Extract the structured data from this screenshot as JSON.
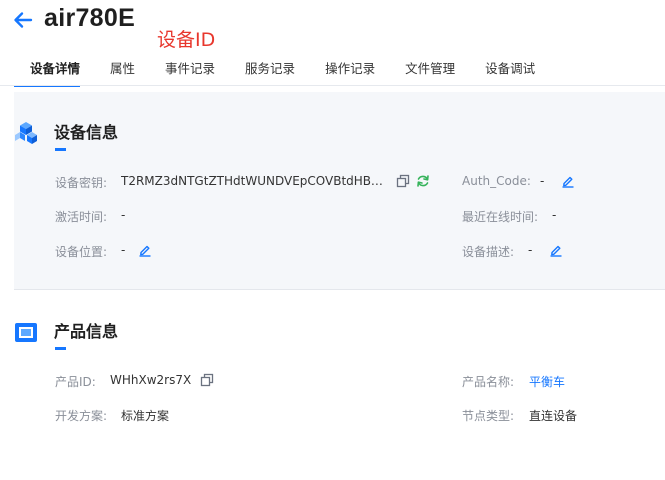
{
  "header": {
    "device_name": "air780E",
    "annotation": "设备ID"
  },
  "tabs": [
    {
      "label": "设备详情",
      "active": true
    },
    {
      "label": "属性",
      "active": false
    },
    {
      "label": "事件记录",
      "active": false
    },
    {
      "label": "服务记录",
      "active": false
    },
    {
      "label": "操作记录",
      "active": false
    },
    {
      "label": "文件管理",
      "active": false
    },
    {
      "label": "设备调试",
      "active": false
    }
  ],
  "device_info": {
    "title": "设备信息",
    "secret_label": "设备密钥:",
    "secret_value": "T2RMZ3dNTGtZTHdtWUNDVEpCOVBtdHBO...",
    "auth_label": "Auth_Code:",
    "auth_value": "-",
    "activation_label": "激活时间:",
    "activation_value": "-",
    "last_online_label": "最近在线时间:",
    "last_online_value": "-",
    "location_label": "设备位置:",
    "location_value": "-",
    "description_label": "设备描述:",
    "description_value": "-"
  },
  "product_info": {
    "title": "产品信息",
    "product_id_label": "产品ID:",
    "product_id_value": "WHhXw2rs7X",
    "product_name_label": "产品名称:",
    "product_name_value": "平衡车",
    "dev_plan_label": "开发方案:",
    "dev_plan_value": "标准方案",
    "node_type_label": "节点类型:",
    "node_type_value": "直连设备"
  },
  "colors": {
    "accent": "#1677ff",
    "annotation": "#e8372d",
    "refresh": "#35b35a"
  },
  "icons": [
    "back-arrow-icon",
    "cube-stack-icon",
    "product-box-icon",
    "copy-icon",
    "refresh-icon",
    "edit-icon"
  ]
}
